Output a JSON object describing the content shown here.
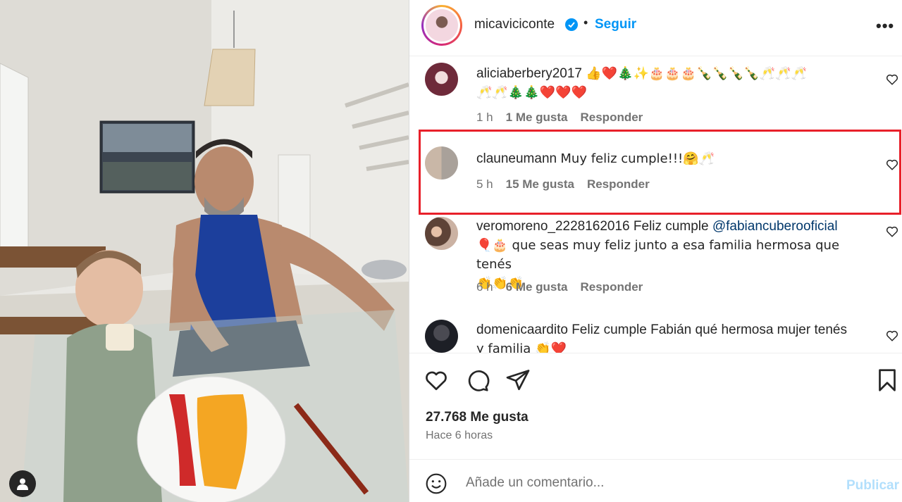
{
  "post": {
    "username": "micaviciconte",
    "separator": "•",
    "follow_label": "Seguir",
    "more_label": "•••"
  },
  "comments": [
    {
      "user": "aliciaberbery2017",
      "text_line1": "👍❤️🎄✨🎂🎂🎂🍾🍾🍾🍾🥂🥂🥂",
      "text_line2": "🥂🥂🎄🎄❤️❤️❤️",
      "age": "1 h",
      "likes": "1 Me gusta",
      "reply": "Responder"
    },
    {
      "user": "clauneumann",
      "text": "Muy feliz cumple!!!🤗🥂",
      "age": "5 h",
      "likes": "15 Me gusta",
      "reply": "Responder"
    },
    {
      "user": "veromoreno_2228162016",
      "text_prefix": "Feliz cumple ",
      "mention": "@fabiancuberooficial",
      "text_line2": "🎈🎂 que seas muy feliz junto a esa familia hermosa que tenés",
      "text_line3": "👏👏👏",
      "age": "6 h",
      "likes": "6 Me gusta",
      "reply": "Responder"
    },
    {
      "user": "domenicaardito",
      "text": "Feliz cumple Fabián qué hermosa mujer tenés",
      "text_line2": "y familia 👏❤️"
    }
  ],
  "footer": {
    "likes": "27.768 Me gusta",
    "time": "Hace 6 horas",
    "comment_placeholder": "Añade un comentario...",
    "publish_label": "Publicar"
  },
  "icons": {
    "like": "heart-icon",
    "comment": "comment-icon",
    "share": "share-icon",
    "save": "bookmark-icon",
    "emoji": "emoji-icon",
    "tagged": "user-tag-icon"
  },
  "colors": {
    "link": "#0095f6",
    "mention": "#00376b",
    "highlight": "#e8202a",
    "secondary_text": "#737373"
  }
}
